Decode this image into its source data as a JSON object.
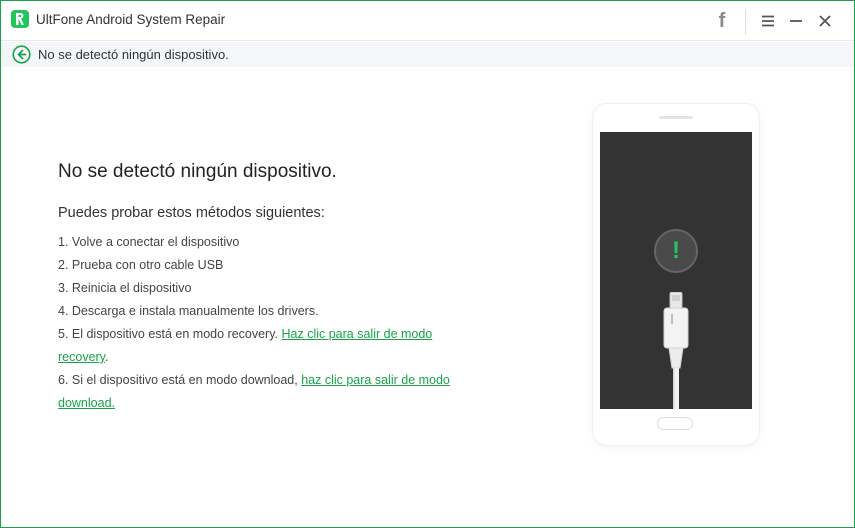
{
  "app": {
    "title": "UltFone Android System Repair",
    "accent_color": "#16a34a"
  },
  "titlebar": {
    "facebook_label": "f",
    "icons": [
      "app-logo-icon",
      "facebook-icon",
      "menu-icon",
      "minimize-icon",
      "close-icon"
    ]
  },
  "status": {
    "text": "No se detectó ningún dispositivo.",
    "icon": "back-arrow-icon"
  },
  "main": {
    "title": "No se detectó ningún dispositivo.",
    "subtitle": "Puedes probar estos métodos siguientes:",
    "steps": [
      {
        "text": "1. Volve a conectar el dispositivo"
      },
      {
        "text": "2. Prueba con otro cable USB"
      },
      {
        "text": "3. Reinicia el dispositivo"
      },
      {
        "text": "4. Descarga e instala manualmente los drivers."
      },
      {
        "text": "5. El dispositivo está en modo recovery. ",
        "link": "Haz clic para salir de modo recovery",
        "after": "."
      },
      {
        "text": "6. Si el dispositivo está en modo download, ",
        "link": "haz clic para salir de modo download.",
        "after": ""
      }
    ]
  },
  "illustration": {
    "alert_symbol": "!",
    "icons": [
      "phone-illustration",
      "alert-icon",
      "usb-cable-icon"
    ]
  }
}
